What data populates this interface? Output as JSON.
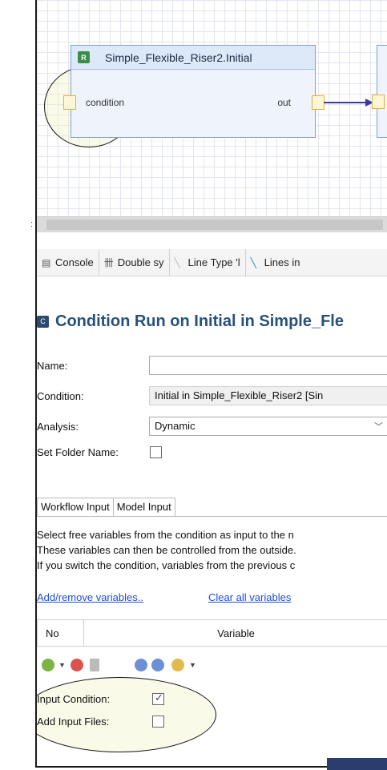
{
  "diagram": {
    "node_title": "Simple_Flexible_Riser2.Initial",
    "node_badge": "R",
    "port_in_label": "condition",
    "port_out_label": "out"
  },
  "tabs": [
    {
      "label": "Console",
      "icon": "console-icon"
    },
    {
      "label": "Double sy",
      "icon": "double-sync-icon"
    },
    {
      "label": "Line Type 'l",
      "icon": "line-type-icon"
    },
    {
      "label": "Lines in",
      "icon": "lines-in-icon"
    }
  ],
  "page": {
    "title": "Condition Run on Initial in Simple_Fle",
    "title_icon": "C"
  },
  "form": {
    "name_label": "Name:",
    "name_value": "",
    "condition_label": "Condition:",
    "condition_value": "Initial in Simple_Flexible_Riser2    [Sin",
    "analysis_label": "Analysis:",
    "analysis_value": "Dynamic",
    "folder_label": "Set Folder Name:"
  },
  "inner_tabs": [
    "Workflow Input",
    "Model Input"
  ],
  "description": [
    "Select free variables from the condition as input to the n",
    "These variables can then be controlled from the outside.",
    "If you switch the condition, variables from the previous c"
  ],
  "links": {
    "add_remove": "Add/remove variables..",
    "clear_all": "Clear all variables"
  },
  "table": {
    "col_no": "No",
    "col_variable": "Variable"
  },
  "options": {
    "input_condition_label": "Input Condition:",
    "input_condition_checked": true,
    "add_input_files_label": "Add Input Files:",
    "add_input_files_checked": false
  }
}
